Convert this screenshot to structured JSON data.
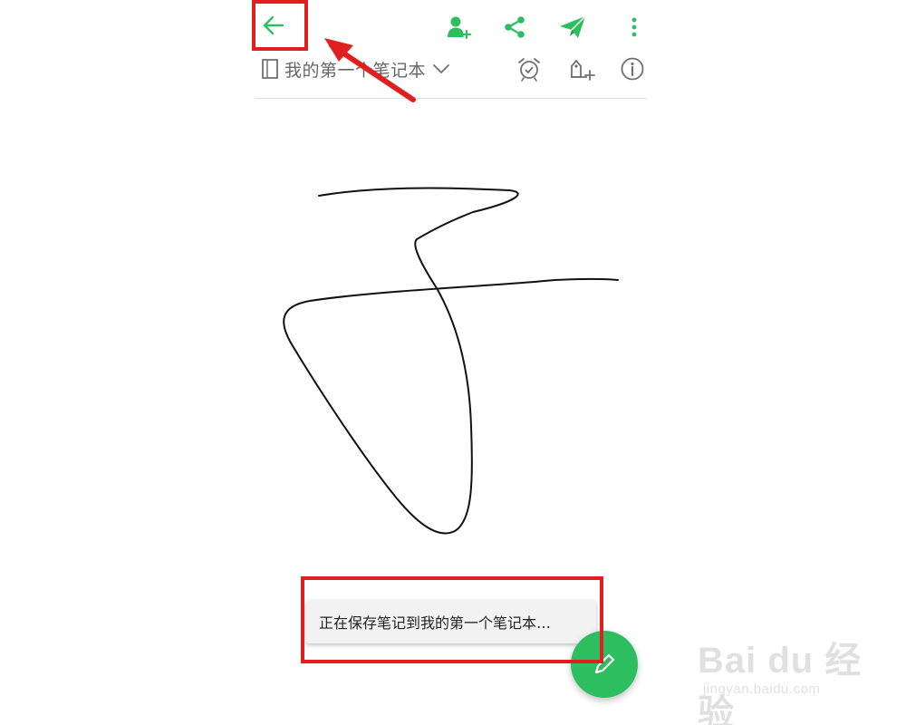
{
  "toolbar": {
    "back_icon": "arrow-left-icon",
    "add_user_icon": "add-user-icon",
    "share_icon": "share-icon",
    "send_icon": "paper-plane-icon",
    "more_icon": "more-vertical-icon"
  },
  "subbar": {
    "notebook_icon": "notebook-icon",
    "notebook_name": "我的第一个笔记本",
    "dropdown_icon": "chevron-down-icon",
    "alarm_icon": "alarm-check-icon",
    "tag_icon": "tag-add-icon",
    "info_icon": "info-icon"
  },
  "toast": {
    "message": "正在保存笔记到我的第一个笔记本…"
  },
  "fab": {
    "icon": "pencil-icon"
  },
  "watermark": {
    "brand": "Bai du 经验",
    "url": "jingyan.baidu.com"
  },
  "colors": {
    "accent_green": "#2dbe60",
    "annotation_red": "#e02020",
    "icon_gray": "#6b6b6b"
  }
}
